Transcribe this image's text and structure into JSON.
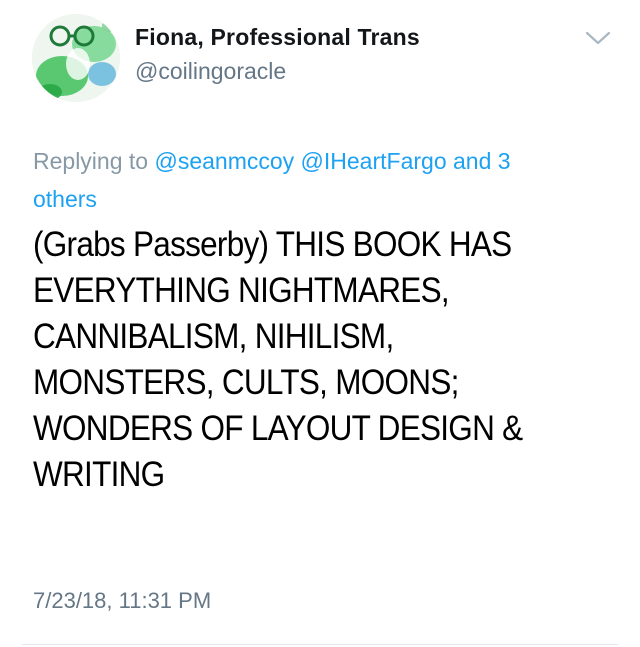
{
  "author": {
    "display_name": "Fiona, Professional Trans",
    "handle": "@coilingoracle",
    "avatar_icon": "profile-avatar"
  },
  "menu_icon": "chevron-down-icon",
  "reply_context": {
    "prefix": "Replying to ",
    "mentions": [
      "@seanmccoy",
      "@IHeartFargo"
    ],
    "separator": " ",
    "connector": " and ",
    "others_line1": "3",
    "others_line2": "others"
  },
  "tweet": {
    "lines": [
      "(Grabs Passerby) THIS BOOK HAS",
      "EVERYTHING NIGHTMARES,",
      "CANNIBALISM, NIHILISM,",
      "MONSTERS, CULTS, MOONS;",
      "WONDERS OF LAYOUT DESIGN &",
      "WRITING"
    ]
  },
  "timestamp": "7/23/18, 11:31 PM",
  "colors": {
    "link": "#1da1f2",
    "secondary_text": "#657786",
    "reply_text": "#8899a6",
    "divider": "#e1e8ed"
  }
}
